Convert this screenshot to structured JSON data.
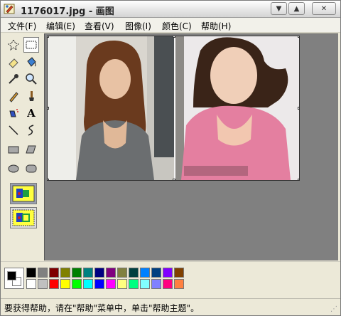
{
  "window": {
    "title": "1176017.jpg - 画图"
  },
  "menu": [
    {
      "label": "文件(F)"
    },
    {
      "label": "编辑(E)"
    },
    {
      "label": "查看(V)"
    },
    {
      "label": "图像(I)"
    },
    {
      "label": "颜色(C)"
    },
    {
      "label": "帮助(H)"
    }
  ],
  "tools": [
    {
      "icon": "free-select-icon"
    },
    {
      "icon": "rect-select-icon",
      "active": true
    },
    {
      "icon": "eraser-icon"
    },
    {
      "icon": "fill-bucket-icon"
    },
    {
      "icon": "color-picker-icon"
    },
    {
      "icon": "magnifier-icon"
    },
    {
      "icon": "pencil-icon"
    },
    {
      "icon": "brush-icon"
    },
    {
      "icon": "airbrush-icon"
    },
    {
      "icon": "text-icon"
    },
    {
      "icon": "line-icon"
    },
    {
      "icon": "curve-icon"
    },
    {
      "icon": "rectangle-icon"
    },
    {
      "icon": "polygon-icon"
    },
    {
      "icon": "ellipse-icon"
    },
    {
      "icon": "rounded-rect-icon"
    }
  ],
  "tool_text_label": "A",
  "palette": {
    "foreground": "#000000",
    "background": "#ffffff",
    "row1": [
      "#000000",
      "#808080",
      "#800000",
      "#808000",
      "#008000",
      "#008080",
      "#000080",
      "#800080",
      "#808040",
      "#004040",
      "#0080ff",
      "#004080",
      "#8000ff",
      "#804000"
    ],
    "row2": [
      "#ffffff",
      "#c0c0c0",
      "#ff0000",
      "#ffff00",
      "#00ff00",
      "#00ffff",
      "#0000ff",
      "#ff00ff",
      "#ffff80",
      "#00ff80",
      "#80ffff",
      "#8080ff",
      "#ff0080",
      "#ff8040"
    ]
  },
  "status": {
    "text": "要获得帮助，请在\"帮助\"菜单中，单击\"帮助主题\"。"
  }
}
